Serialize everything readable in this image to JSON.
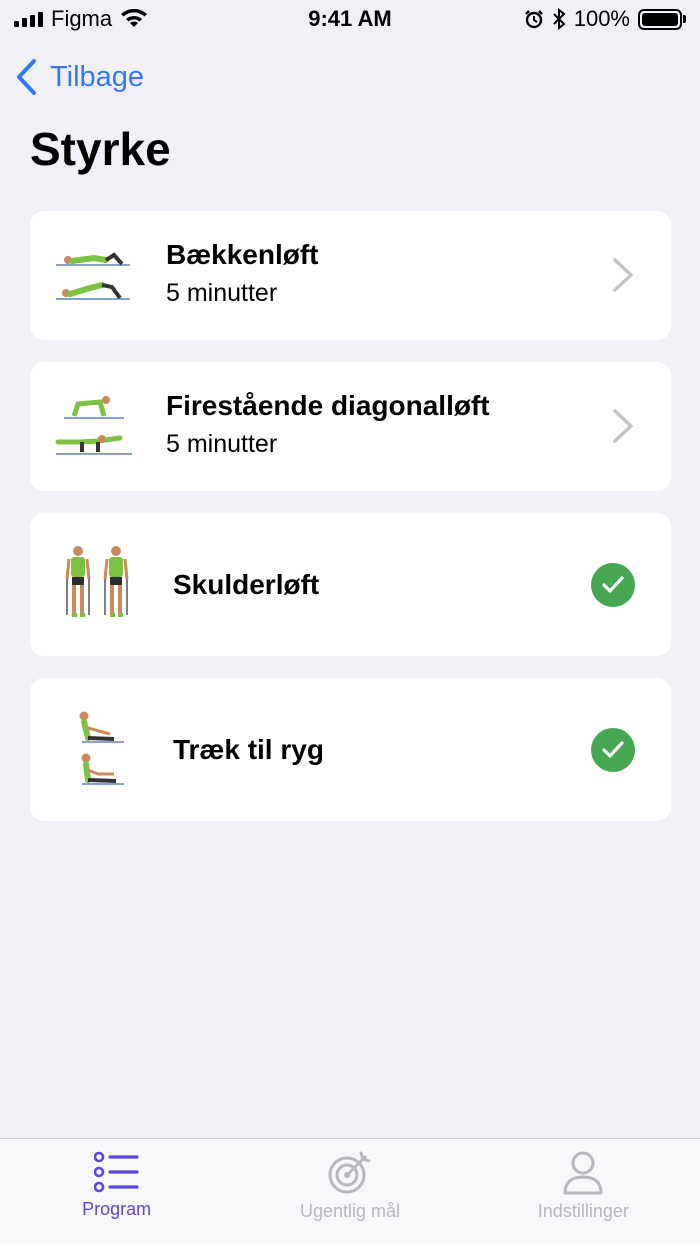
{
  "status_bar": {
    "carrier": "Figma",
    "time": "9:41 AM",
    "battery": "100%"
  },
  "nav": {
    "back_label": "Tilbage"
  },
  "page": {
    "title": "Styrke"
  },
  "exercises": [
    {
      "title": "Bækkenløft",
      "duration": "5 minutter",
      "status": "chevron"
    },
    {
      "title": "Firestående diagonalløft",
      "duration": "5 minutter",
      "status": "chevron"
    },
    {
      "title": "Skulderløft",
      "status": "completed"
    },
    {
      "title": "Træk til ryg",
      "status": "completed"
    }
  ],
  "tab_bar": {
    "tabs": [
      {
        "label": "Program",
        "icon": "list-icon",
        "active": true
      },
      {
        "label": "Ugentlig mål",
        "icon": "target-icon",
        "active": false
      },
      {
        "label": "Indstillinger",
        "icon": "person-icon",
        "active": false
      }
    ]
  },
  "colors": {
    "accent": "#3478f6",
    "tab_active": "#5a48d6",
    "check_green": "#46a651",
    "shirt_green": "#7cc142"
  }
}
